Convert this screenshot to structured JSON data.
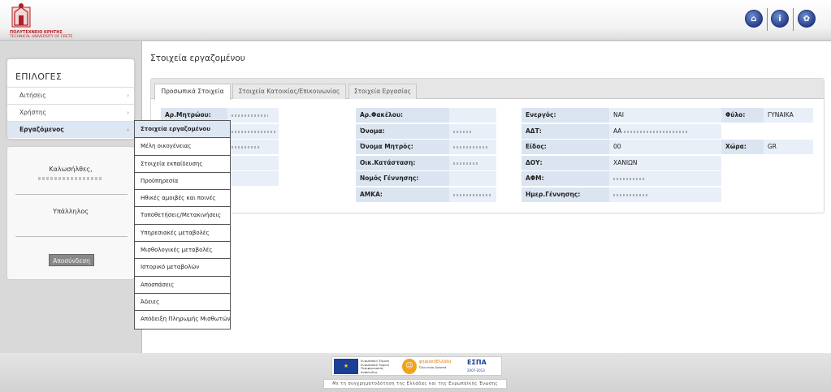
{
  "header": {
    "logo_line1": "ΠΟΛΥΤΕΧΝΕΙΟ ΚΡΗΤΗΣ",
    "logo_line2": "TECHNICAL UNIVERSITY OF CRETE",
    "buttons": [
      {
        "name": "home",
        "glyph": "⌂"
      },
      {
        "name": "info",
        "glyph": "i"
      },
      {
        "name": "settings",
        "glyph": "✿"
      }
    ],
    "brand_color": "#27408f",
    "logo_color": "#b01f24"
  },
  "sidebar": {
    "title": "ΕΠΙΛΟΓΕΣ",
    "items": [
      {
        "label": "Αιτήσεις"
      },
      {
        "label": "Χρήστης"
      },
      {
        "label": "Εργαζόμενος"
      }
    ],
    "welcome": "Καλωσήλθες,",
    "role": "Υπάλληλος",
    "logout_label": "Αποσύνδεση"
  },
  "submenu": {
    "items": [
      "Στοιχεία εργαζομένου",
      "Μέλη οικογένειας",
      "Στοιχεία εκπαίδευσης",
      "Προϋπηρεσία",
      "Ηθικές αμοιβές και ποινές",
      "Τοποθετήσεις/Μετακινήσεις",
      "Υπηρεσιακές μεταβολές",
      "Μισθολογικές μεταβολές",
      "Ιστορικό μεταβολών",
      "Αποσπάσεις",
      "Άδειες",
      "Απόδειξη Πληρωμής Μισθωτών"
    ]
  },
  "main": {
    "title": "Στοιχεία εργαζομένου",
    "tabs": [
      "Προσωπικά Στοιχεία",
      "Στοιχεία Κατοικίας/Επικοινωνίας",
      "Στοιχεία Εργασίας"
    ],
    "fields": {
      "ar_mitroou": "Αρ.Μητρώου:",
      "ar_fakelou": "Αρ.Φακέλου:",
      "energos": "Ενεργός:",
      "energos_value": "ΝΑΙ",
      "fylo": "Φύλο:",
      "fylo_value": "ΓΥΝΑΙΚΑ",
      "onoma": "Όνομα:",
      "adt": "ΑΔΤ:",
      "adt_prefix": "ΑΑ",
      "onoma_mitros": "Όνομα Μητρός:",
      "eidos": "Είδος:",
      "eidos_value": "00",
      "xora": "Χώρα:",
      "xora_value": "GR",
      "oik_katastasi": "Οικ.Κατάσταση:",
      "doy": "ΔΟΥ:",
      "doy_value": "ΧΑΝΙΩΝ",
      "nomos_gennisis": "Νομός Γέννησης:",
      "afm": "ΑΦΜ:",
      "amka": "ΑΜΚΑ:",
      "im_gennisis": "Ημερ.Γέννησης:"
    }
  },
  "footer": {
    "eu_line1": "Ευρωπαϊκή Ένωση",
    "eu_line2": "Ευρωπαϊκό Ταμείο",
    "eu_line3": "Περιφερειακής",
    "eu_line4": "Ανάπτυξης",
    "psifiaki": "ψηφιακήΕλλάδα",
    "psifiaki_sub": "Όλα είναι δυνατά",
    "espa": "ΕΣΠΑ",
    "espa_years": "2007-2013",
    "cofund": "Με τη συγχρηματοδότηση της Ελλάδας και της Ευρωπαϊκής Ένωσης"
  }
}
